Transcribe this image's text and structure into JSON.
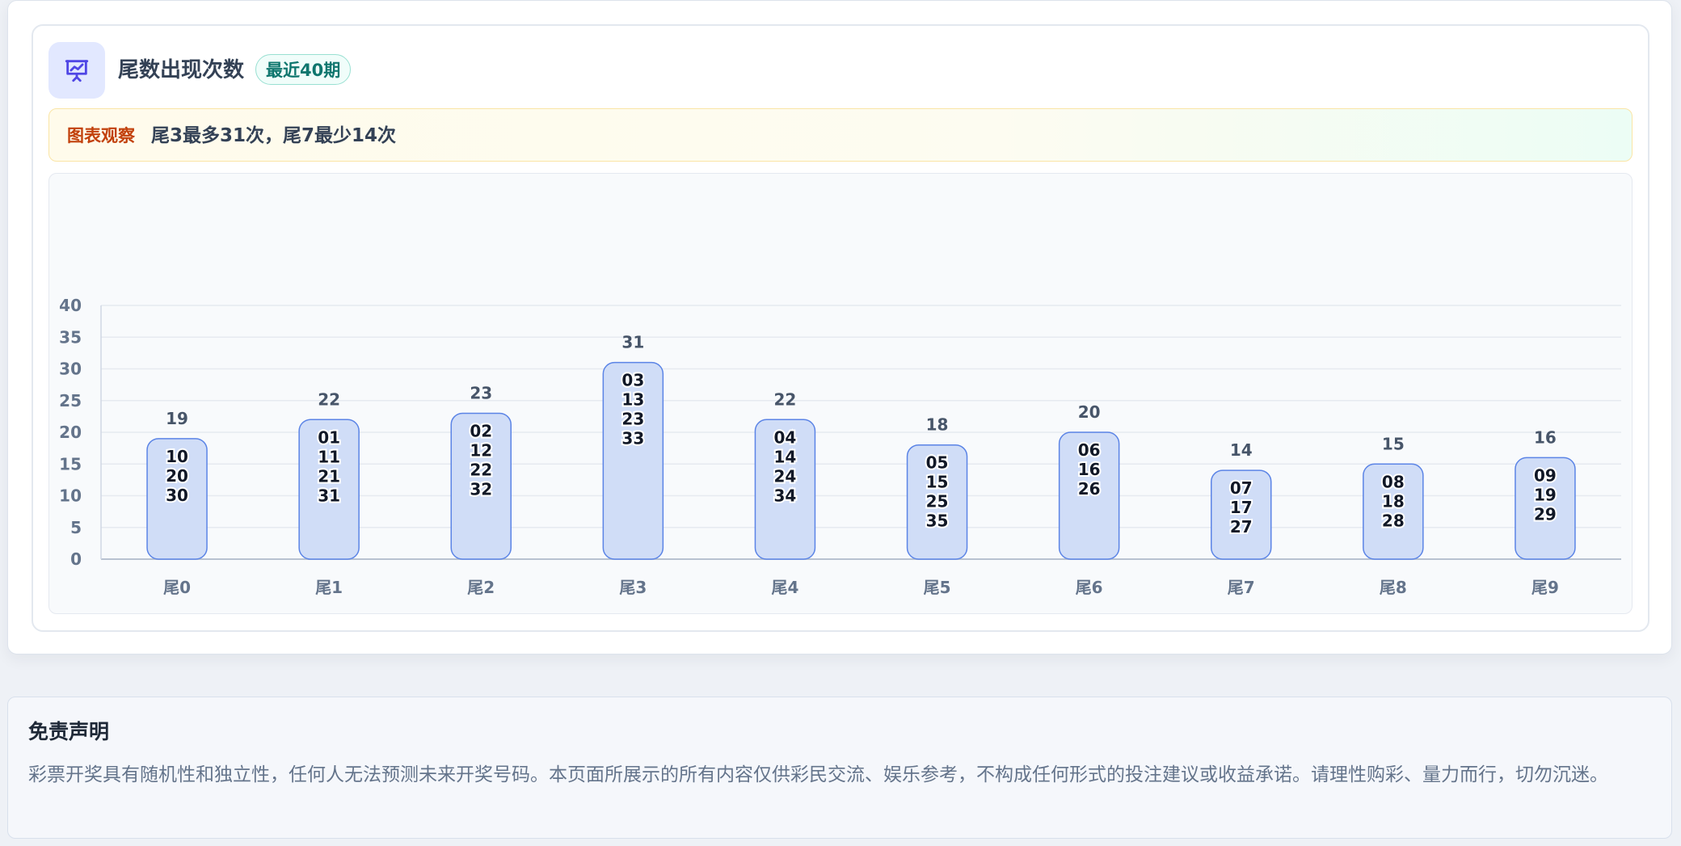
{
  "card": {
    "title": "尾数出现次数",
    "badge": "最近40期",
    "icon": "presentation-chart-icon"
  },
  "insight": {
    "tag": "图表观察",
    "text": "尾3最多31次，尾7最少14次"
  },
  "chart_data": {
    "type": "bar",
    "categories": [
      "尾0",
      "尾1",
      "尾2",
      "尾3",
      "尾4",
      "尾5",
      "尾6",
      "尾7",
      "尾8",
      "尾9"
    ],
    "values": [
      19,
      22,
      23,
      31,
      22,
      18,
      20,
      14,
      15,
      16
    ],
    "bar_numbers": [
      [
        "10",
        "20",
        "30"
      ],
      [
        "01",
        "11",
        "21",
        "31"
      ],
      [
        "02",
        "12",
        "22",
        "32"
      ],
      [
        "03",
        "13",
        "23",
        "33"
      ],
      [
        "04",
        "14",
        "24",
        "34"
      ],
      [
        "05",
        "15",
        "25",
        "35"
      ],
      [
        "06",
        "16",
        "26"
      ],
      [
        "07",
        "17",
        "27"
      ],
      [
        "08",
        "18",
        "28"
      ],
      [
        "09",
        "19",
        "29"
      ]
    ],
    "yticks": [
      "0",
      "5",
      "10",
      "15",
      "20",
      "25",
      "30",
      "35",
      "40"
    ],
    "ylim": [
      0,
      40
    ],
    "grid": true,
    "colors": {
      "bar_fill": "#d0ddf7",
      "bar_stroke": "#5b84e6",
      "grid": "#e6eaf0",
      "tick_text": "#64748b",
      "value_text": "#475569"
    }
  },
  "disclaimer": {
    "title": "免责声明",
    "text": "彩票开奖具有随机性和独立性，任何人无法预测未来开奖号码。本页面所展示的所有内容仅供彩民交流、娱乐参考，不构成任何形式的投注建议或收益承诺。请理性购彩、量力而行，切勿沉迷。"
  }
}
